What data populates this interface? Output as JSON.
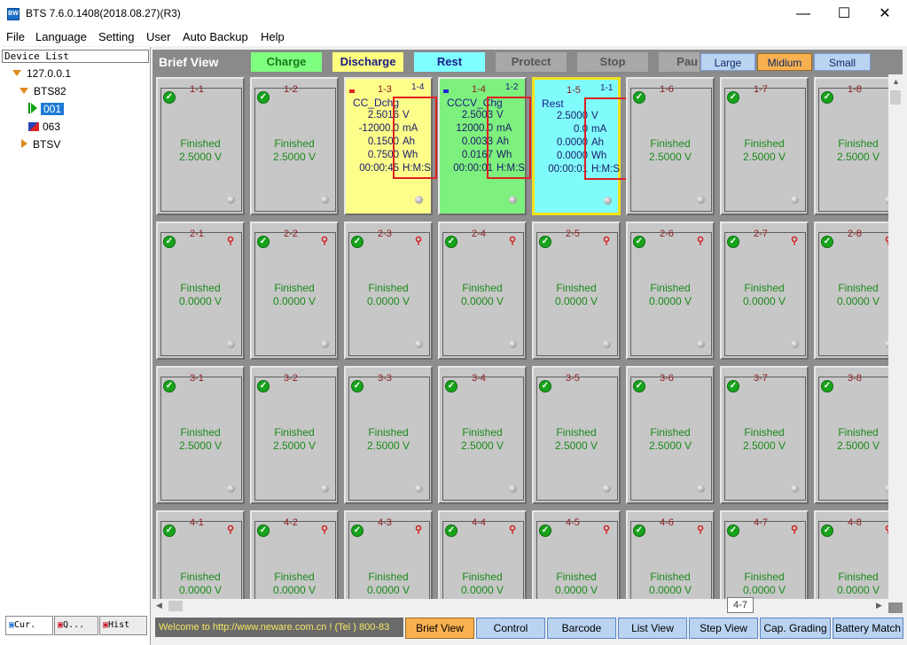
{
  "window": {
    "title": "BTS 7.6.0.1408(2018.08.27)(R3)",
    "minimize": "—",
    "maximize": "☐",
    "close": "✕"
  },
  "menu": [
    "File",
    "Language",
    "Setting",
    "User",
    "Auto Backup",
    "Help"
  ],
  "sidebar": {
    "header": "Device List",
    "nodes": {
      "ip": "127.0.0.1",
      "bts": "BTS82",
      "unit1": "001",
      "unit2": "063",
      "btsv": "BTSV"
    },
    "tabs": [
      "Cur.",
      "Q...",
      "Hist"
    ]
  },
  "toolbar": {
    "brief_view": "Brief View",
    "legend": [
      {
        "label": "Charge",
        "color": "#7fff7f"
      },
      {
        "label": "Discharge",
        "color": "#ffff7f"
      },
      {
        "label": "Rest",
        "color": "#7fffff"
      },
      {
        "label": "Protect",
        "color": "#a8a8a8"
      },
      {
        "label": "Stop",
        "color": "#a8a8a8"
      },
      {
        "label": "Pau",
        "color": "#a8a8a8"
      }
    ],
    "sizes": [
      {
        "label": "Large",
        "active": false
      },
      {
        "label": "Midium",
        "active": true
      },
      {
        "label": "Small",
        "active": false
      }
    ]
  },
  "cells": {
    "row1": [
      {
        "id": "1-1",
        "status": "Finished",
        "volt": "2.5000  V"
      },
      {
        "id": "1-2",
        "status": "Finished",
        "volt": "2.5000  V"
      },
      {
        "id": "1-3",
        "tag": "1-4",
        "mode": "CC_Dchg",
        "v": "2.5016",
        "i": "-12000.0",
        "ah": "0.1500",
        "wh": "0.7500",
        "t": "00:00:45"
      },
      {
        "id": "1-4",
        "tag": "1-2",
        "mode": "CCCV_Chg",
        "v": "2.5003",
        "i": "12000.0",
        "ah": "0.0033",
        "wh": "0.0167",
        "t": "00:00:01"
      },
      {
        "id": "1-5",
        "tag": "1-1",
        "mode": "Rest",
        "v": "2.5000",
        "i": "0.0",
        "ah": "0.0000",
        "wh": "0.0000",
        "t": "00:00:01"
      },
      {
        "id": "1-6",
        "status": "Finished",
        "volt": "2.5000  V"
      },
      {
        "id": "1-7",
        "status": "Finished",
        "volt": "2.5000  V"
      },
      {
        "id": "1-8",
        "status": "Finished",
        "volt": "2.5000  V"
      }
    ],
    "units": {
      "v": "V",
      "i": "mA",
      "ah": "Ah",
      "wh": "Wh",
      "t": "H:M:S"
    },
    "row2": [
      {
        "id": "2-1",
        "status": "Finished",
        "volt": "0.0000  V"
      },
      {
        "id": "2-2",
        "status": "Finished",
        "volt": "0.0000  V"
      },
      {
        "id": "2-3",
        "status": "Finished",
        "volt": "0.0000  V"
      },
      {
        "id": "2-4",
        "status": "Finished",
        "volt": "0.0000  V"
      },
      {
        "id": "2-5",
        "status": "Finished",
        "volt": "0.0000  V"
      },
      {
        "id": "2-6",
        "status": "Finished",
        "volt": "0.0000  V"
      },
      {
        "id": "2-7",
        "status": "Finished",
        "volt": "0.0000  V"
      },
      {
        "id": "2-8",
        "status": "Finished",
        "volt": "0.0000  V"
      }
    ],
    "row3": [
      {
        "id": "3-1",
        "status": "Finished",
        "volt": "2.5000  V"
      },
      {
        "id": "3-2",
        "status": "Finished",
        "volt": "2.5000  V"
      },
      {
        "id": "3-3",
        "status": "Finished",
        "volt": "2.5000  V"
      },
      {
        "id": "3-4",
        "status": "Finished",
        "volt": "2.5000  V"
      },
      {
        "id": "3-5",
        "status": "Finished",
        "volt": "2.5000  V"
      },
      {
        "id": "3-6",
        "status": "Finished",
        "volt": "2.5000  V"
      },
      {
        "id": "3-7",
        "status": "Finished",
        "volt": "2.5000  V"
      },
      {
        "id": "3-8",
        "status": "Finished",
        "volt": "2.5000  V"
      }
    ],
    "row4": [
      {
        "id": "4-1",
        "status": "Finished",
        "volt": "0.0000  V"
      },
      {
        "id": "4-2",
        "status": "Finished",
        "volt": "0.0000  V"
      },
      {
        "id": "4-3",
        "status": "Finished",
        "volt": "0.0000  V"
      },
      {
        "id": "4-4",
        "status": "Finished",
        "volt": "0.0000  V"
      },
      {
        "id": "4-5",
        "status": "Finished",
        "volt": "0.0000  V"
      },
      {
        "id": "4-6",
        "status": "Finished",
        "volt": "0.0000  V"
      },
      {
        "id": "4-7",
        "status": "Finished",
        "volt": "0.0000  V"
      },
      {
        "id": "4-8",
        "status": "Finished",
        "volt": "0.0000  V"
      }
    ]
  },
  "tooltip": "4-7",
  "statusbar": {
    "welcome": "Welcome to http://www.neware.com.cn !    (Tel ) 800-83",
    "tabs": [
      {
        "label": "Brief View",
        "active": true
      },
      {
        "label": "Control",
        "active": false
      },
      {
        "label": "Barcode",
        "active": false
      },
      {
        "label": "List View",
        "active": false
      },
      {
        "label": "Step View",
        "active": false
      },
      {
        "label": "Cap. Grading",
        "active": false
      },
      {
        "label": "Battery Match",
        "active": false
      }
    ]
  }
}
